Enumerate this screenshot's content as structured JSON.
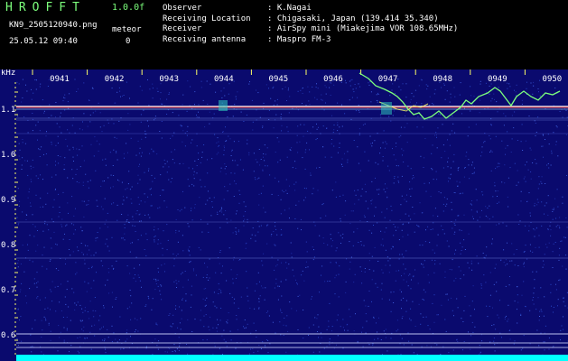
{
  "header": {
    "app_title": "HROFFT",
    "version": "1.0.0f",
    "filename": "KN9_2505120940.png",
    "datetime": "25.05.12 09:40",
    "meteor_label": "meteor",
    "meteor_count": "0"
  },
  "info": [
    {
      "label": "Observer",
      "value": ": K.Nagai"
    },
    {
      "label": "Receiving Location",
      "value": ": Chigasaki, Japan (139.414 35.340)"
    },
    {
      "label": "Receiver",
      "value": ": AirSpy mini (Miakejima VOR 108.65MHz)"
    },
    {
      "label": "Receiving antenna",
      "value": ": Maspro FM-3"
    }
  ],
  "spectrogram": {
    "unit_label": "kHz",
    "time_labels": [
      "0941",
      "0942",
      "0943",
      "0944",
      "0945",
      "0946",
      "0947",
      "0948",
      "0949",
      "0950"
    ],
    "freq_ticks": [
      "1.1",
      "1.0",
      "0.9",
      "0.8",
      "0.7",
      "0.6"
    ],
    "colors": {
      "background": "#0a0a6e",
      "tick": "#ffff66",
      "trace": "#7cff7c",
      "carrier": "#ff4040",
      "floor": "#00ffff"
    }
  }
}
